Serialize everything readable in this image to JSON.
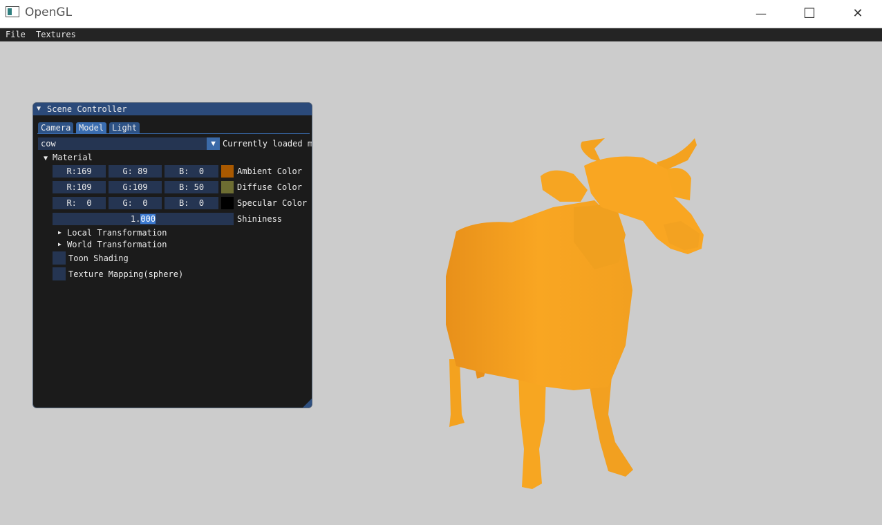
{
  "window": {
    "title": "OpenGL",
    "minimize_symbol": "—",
    "maximize_symbol": "☐",
    "close_symbol": "✕"
  },
  "menubar": {
    "items": [
      "File",
      "Textures"
    ]
  },
  "panel": {
    "title": "Scene Controller",
    "tabs": [
      "Camera",
      "Model",
      "Light"
    ],
    "active_tab": "Model",
    "model_combo": {
      "value": "cow",
      "label": "Currently loaded m"
    },
    "material": {
      "header": "Material",
      "ambient": {
        "r": "R:169",
        "g": "G: 89",
        "b": "B:  0",
        "label": "Ambient Color",
        "color": "#a95900"
      },
      "diffuse": {
        "r": "R:109",
        "g": "G:109",
        "b": "B: 50",
        "label": "Diffuse Color",
        "color": "#6d6d32"
      },
      "specular": {
        "r": "R:  0",
        "g": "G:  0",
        "b": "B:  0",
        "label": "Specular  Color",
        "color": "#000000"
      },
      "shininess": {
        "value_before": "1.",
        "value_selected": "000",
        "label": "Shininess"
      }
    },
    "sections": [
      "Local Transformation",
      "World Transformation"
    ],
    "checkboxes": [
      "Toon Shading",
      "Texture Mapping(sphere)"
    ]
  },
  "model_color": "#f9a622"
}
